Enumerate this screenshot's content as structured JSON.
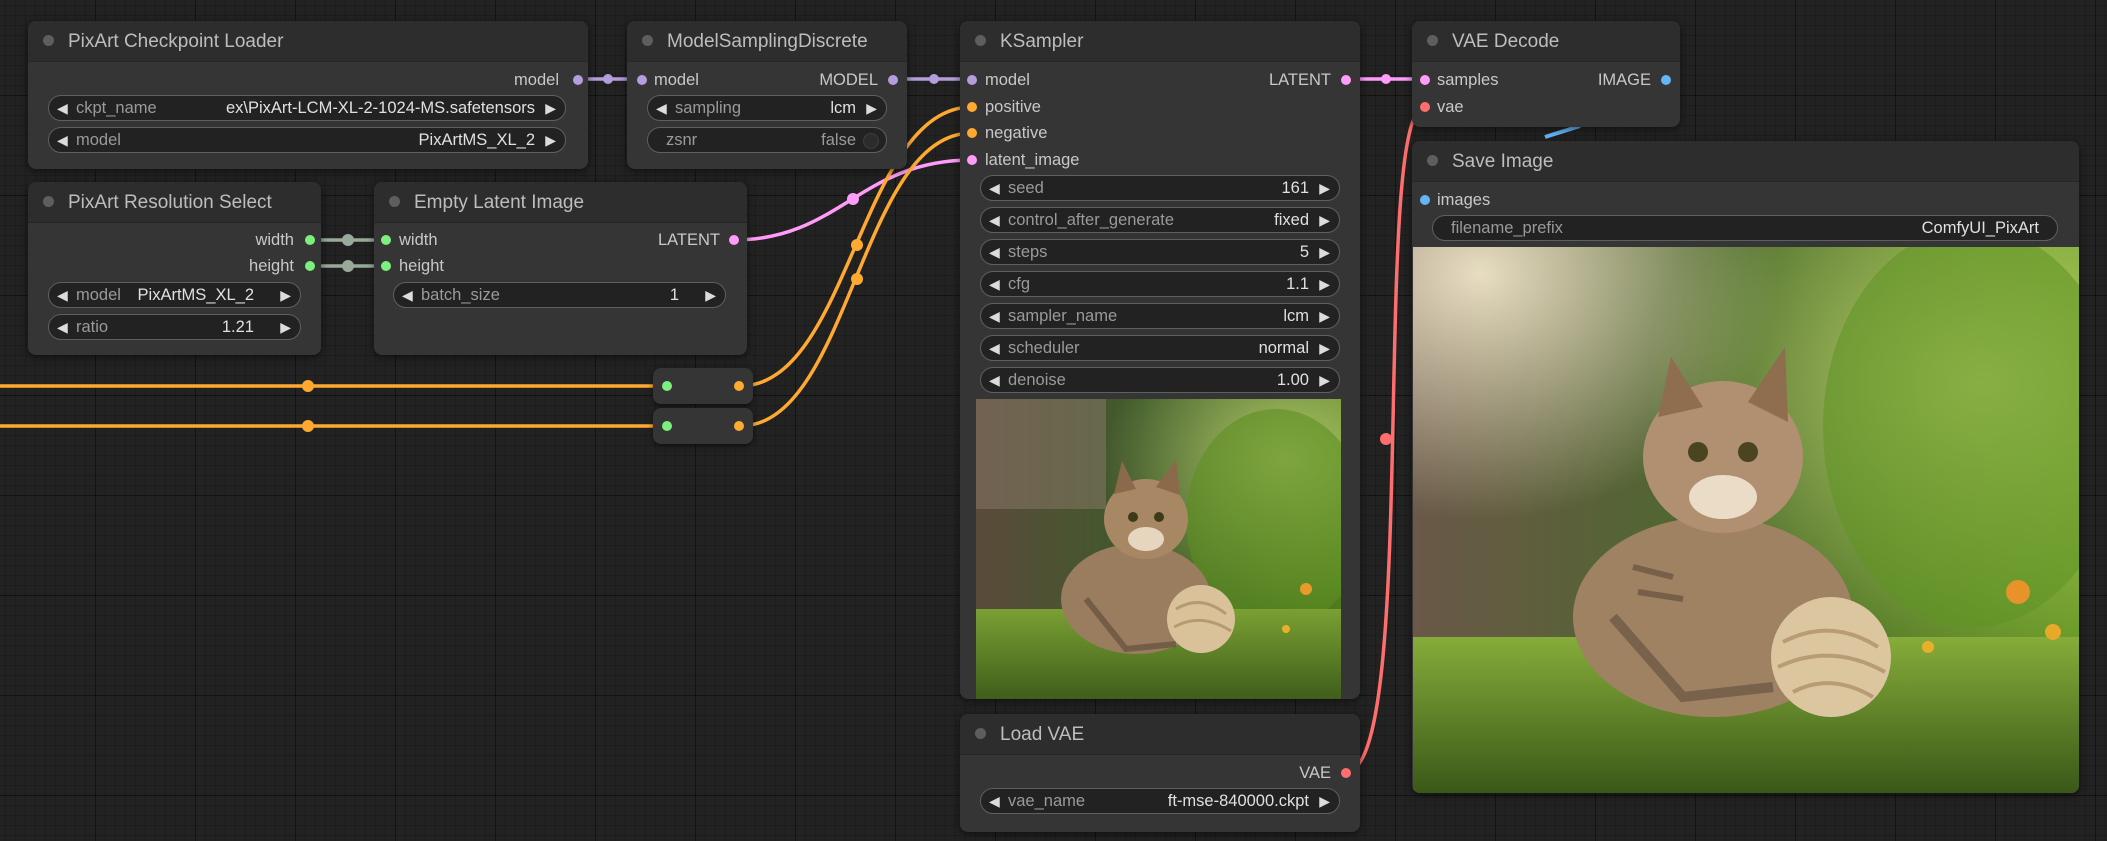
{
  "colors": {
    "model": "#b39ddb",
    "clip_conditioning": "#ffa931",
    "latent": "#ff9cf9",
    "vae": "#ff6e6e",
    "image": "#64b5f6",
    "int": "#7cf07c"
  },
  "nodes": {
    "checkpoint": {
      "title": "PixArt Checkpoint Loader",
      "out_model": "model",
      "ckpt_name_label": "ckpt_name",
      "ckpt_name_value": "ex\\PixArt-LCM-XL-2-1024-MS.safetensors",
      "model_label": "model",
      "model_value": "PixArtMS_XL_2"
    },
    "sampling": {
      "title": "ModelSamplingDiscrete",
      "in_model": "model",
      "out_model": "MODEL",
      "sampling_label": "sampling",
      "sampling_value": "lcm",
      "zsnr_label": "zsnr",
      "zsnr_value": "false"
    },
    "ksampler": {
      "title": "KSampler",
      "in_model": "model",
      "in_positive": "positive",
      "in_negative": "negative",
      "in_latent": "latent_image",
      "out_latent": "LATENT",
      "widgets": [
        {
          "label": "seed",
          "value": "161"
        },
        {
          "label": "control_after_generate",
          "value": "fixed"
        },
        {
          "label": "steps",
          "value": "5"
        },
        {
          "label": "cfg",
          "value": "1.1"
        },
        {
          "label": "sampler_name",
          "value": "lcm"
        },
        {
          "label": "scheduler",
          "value": "normal"
        },
        {
          "label": "denoise",
          "value": "1.00"
        }
      ]
    },
    "vae_decode": {
      "title": "VAE Decode",
      "in_samples": "samples",
      "in_vae": "vae",
      "out_image": "IMAGE"
    },
    "resolution": {
      "title": "PixArt Resolution Select",
      "out_width": "width",
      "out_height": "height",
      "model_label": "model",
      "model_value": "PixArtMS_XL_2",
      "ratio_label": "ratio",
      "ratio_value": "1.21"
    },
    "empty_latent": {
      "title": "Empty Latent Image",
      "in_width": "width",
      "in_height": "height",
      "out_latent": "LATENT",
      "batch_label": "batch_size",
      "batch_value": "1"
    },
    "save_image": {
      "title": "Save Image",
      "in_images": "images",
      "prefix_label": "filename_prefix",
      "prefix_value": "ComfyUI_PixArt"
    },
    "load_vae": {
      "title": "Load VAE",
      "out_vae": "VAE",
      "vae_name_label": "vae_name",
      "vae_name_value": "ft-mse-840000.ckpt"
    }
  }
}
